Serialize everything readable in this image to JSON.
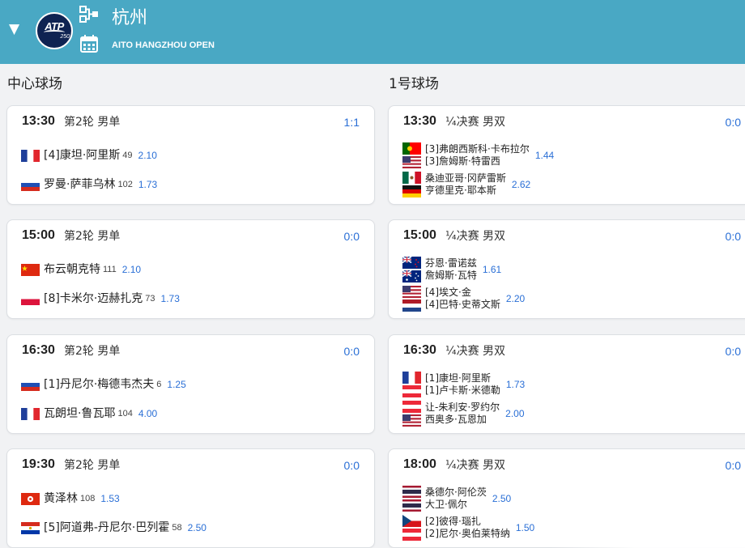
{
  "header": {
    "title": "杭州",
    "subtitle": "AITO HANGZHOU OPEN",
    "logo_text": "ATP",
    "logo_number": "250",
    "colors": {
      "bar": "#49a8c4",
      "logo": "#0f2352",
      "link": "#2a6fd6"
    },
    "icons": [
      "caret-down-icon",
      "draw-bracket-icon",
      "calendar-icon"
    ]
  },
  "columns": [
    {
      "title": "中心球场",
      "matches": [
        {
          "time": "13:30",
          "round": "第2轮 男单",
          "score": "1:1",
          "sides": [
            {
              "players": [
                {
                  "flag": "FR",
                  "name": "[4]康坦·阿里斯"
                }
              ],
              "rank": "49",
              "odds": "2.10"
            },
            {
              "players": [
                {
                  "flag": "RU",
                  "name": "罗曼·萨菲乌林"
                }
              ],
              "rank": "102",
              "odds": "1.73"
            }
          ]
        },
        {
          "time": "15:00",
          "round": "第2轮 男单",
          "score": "0:0",
          "sides": [
            {
              "players": [
                {
                  "flag": "CN",
                  "name": "布云朝克特"
                }
              ],
              "rank": "111",
              "odds": "2.10"
            },
            {
              "players": [
                {
                  "flag": "PL",
                  "name": "[8]卡米尔·迈赫扎克"
                }
              ],
              "rank": "73",
              "odds": "1.73"
            }
          ]
        },
        {
          "time": "16:30",
          "round": "第2轮 男单",
          "score": "0:0",
          "sides": [
            {
              "players": [
                {
                  "flag": "RU",
                  "name": "[1]丹尼尔·梅德韦杰夫"
                }
              ],
              "rank": "6",
              "odds": "1.25"
            },
            {
              "players": [
                {
                  "flag": "FR",
                  "name": "瓦朗坦·鲁瓦耶"
                }
              ],
              "rank": "104",
              "odds": "4.00"
            }
          ]
        },
        {
          "time": "19:30",
          "round": "第2轮 男单",
          "score": "0:0",
          "sides": [
            {
              "players": [
                {
                  "flag": "HK",
                  "name": "黄泽林"
                }
              ],
              "rank": "108",
              "odds": "1.53"
            },
            {
              "players": [
                {
                  "flag": "PY",
                  "name": "[5]阿道弗-丹尼尔·巴列霍"
                }
              ],
              "rank": "58",
              "odds": "2.50"
            }
          ]
        }
      ]
    },
    {
      "title": "1号球场",
      "matches": [
        {
          "time": "13:30",
          "round": "¼决赛 男双",
          "score": "0:0",
          "sides": [
            {
              "players": [
                {
                  "flag": "PT",
                  "name": "[3]弗朗西斯科·卡布拉尔"
                },
                {
                  "flag": "US",
                  "name": "[3]詹姆斯·特雷西"
                }
              ],
              "odds": "1.44"
            },
            {
              "players": [
                {
                  "flag": "MX",
                  "name": "桑迪亚哥·冈萨雷斯"
                },
                {
                  "flag": "DE",
                  "name": "亨德里克·耶本斯"
                }
              ],
              "odds": "2.62"
            }
          ]
        },
        {
          "time": "15:00",
          "round": "¼决赛 男双",
          "score": "0:0",
          "sides": [
            {
              "players": [
                {
                  "flag": "NZ",
                  "name": "芬恩·雷诺兹"
                },
                {
                  "flag": "AU",
                  "name": "詹姆斯·瓦特"
                }
              ],
              "odds": "1.61"
            },
            {
              "players": [
                {
                  "flag": "US",
                  "name": "[4]埃文·金"
                },
                {
                  "flag": "NL",
                  "name": "[4]巴特·史蒂文斯"
                }
              ],
              "odds": "2.20"
            }
          ]
        },
        {
          "time": "16:30",
          "round": "¼决赛 男双",
          "score": "0:0",
          "sides": [
            {
              "players": [
                {
                  "flag": "FR",
                  "name": "[1]康坦·阿里斯"
                },
                {
                  "flag": "AT",
                  "name": "[1]卢卡斯·米德勒"
                }
              ],
              "odds": "1.73"
            },
            {
              "players": [
                {
                  "flag": "AT",
                  "name": "让-朱利安·罗约尔"
                },
                {
                  "flag": "US",
                  "name": "西奥多·瓦恩加"
                }
              ],
              "odds": "2.00"
            }
          ]
        },
        {
          "time": "18:00",
          "round": "¼决赛 男双",
          "score": "0:0",
          "sides": [
            {
              "players": [
                {
                  "flag": "TH",
                  "name": "桑德尔·阿伦茨"
                },
                {
                  "flag": "TH",
                  "name": "大卫·佩尔"
                }
              ],
              "odds": "2.50"
            },
            {
              "players": [
                {
                  "flag": "CZ",
                  "name": "[2]彼得·瑙扎"
                },
                {
                  "flag": "AT",
                  "name": "[2]尼尔·奥伯莱特纳"
                }
              ],
              "odds": "1.50"
            }
          ]
        }
      ]
    }
  ]
}
